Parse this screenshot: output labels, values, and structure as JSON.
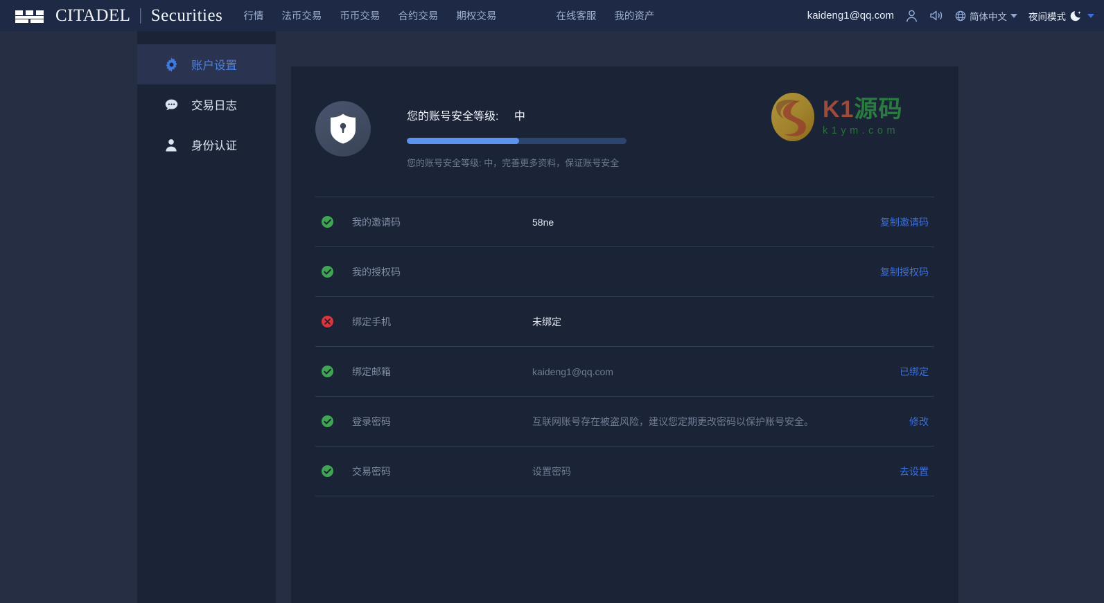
{
  "header": {
    "brand": {
      "mark": "castle-battlement-icon",
      "name": "CITADEL",
      "divider": "|",
      "suffix": "Securities"
    },
    "nav": [
      {
        "label": "行情",
        "name": "markets"
      },
      {
        "label": "法币交易",
        "name": "fiat-trading"
      },
      {
        "label": "币币交易",
        "name": "spot-trading"
      },
      {
        "label": "合约交易",
        "name": "futures-trading"
      },
      {
        "label": "期权交易",
        "name": "options-trading"
      },
      {
        "label": "在线客服",
        "name": "online-support"
      },
      {
        "label": "我的资产",
        "name": "my-assets"
      }
    ],
    "user_email": "kaideng1@qq.com",
    "user_icon": "user-icon",
    "sound_icon": "speaker-icon",
    "globe_icon": "globe-icon",
    "language": "简体中文",
    "night_mode": "夜间模式",
    "moon_icon": "moon-icon"
  },
  "sidebar": {
    "items": [
      {
        "label": "账户设置",
        "icon": "gear-icon",
        "active": true
      },
      {
        "label": "交易日志",
        "icon": "chat-bubble-icon",
        "active": false
      },
      {
        "label": "身份认证",
        "icon": "person-icon",
        "active": false
      }
    ]
  },
  "security": {
    "shield_icon": "shield-lock-icon",
    "title_prefix": "您的账号安全等级:",
    "level": "中",
    "progress_percent": 51,
    "note": "您的账号安全等级: 中，完善更多资料，保证账号安全"
  },
  "watermark": {
    "logo_icon": "k1-yuanma-logo-icon",
    "text_latin": "K1",
    "text_cn": "源码",
    "domain": "k1ym.com"
  },
  "rows": [
    {
      "status": "ok",
      "label": "我的邀请码",
      "value": "58ne",
      "value_strong": true,
      "action": "复制邀请码"
    },
    {
      "status": "ok",
      "label": "我的授权码",
      "value": "",
      "value_strong": false,
      "action": "复制授权码"
    },
    {
      "status": "fail",
      "label": "绑定手机",
      "value": "未绑定",
      "value_strong": true,
      "action": ""
    },
    {
      "status": "ok",
      "label": "绑定邮箱",
      "value": "kaideng1@qq.com",
      "value_strong": false,
      "action": "已绑定"
    },
    {
      "status": "ok",
      "label": "登录密码",
      "value": "互联网账号存在被盗风险，建议您定期更改密码以保护账号安全。",
      "value_strong": false,
      "action": "修改"
    },
    {
      "status": "ok",
      "label": "交易密码",
      "value": "设置密码",
      "value_strong": false,
      "action": "去设置"
    }
  ],
  "colors": {
    "page_bg": "#252e42",
    "panel_bg": "#1b2336",
    "header_bg": "#1d2945",
    "accent_blue": "#3d6fd6",
    "progress_fill": "#5b93ef",
    "status_ok": "#3fa552",
    "status_fail": "#d6373c"
  }
}
